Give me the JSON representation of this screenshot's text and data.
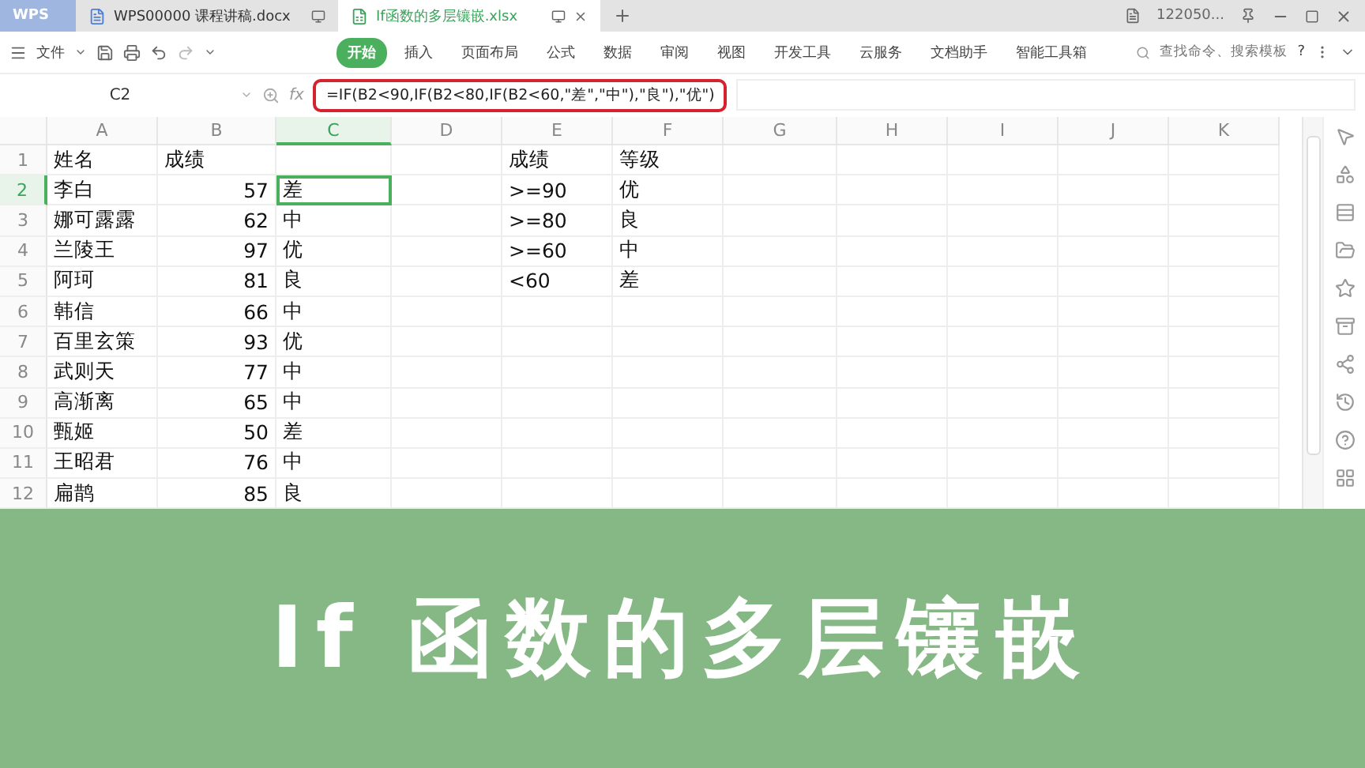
{
  "tabs": [
    {
      "label": "WPS",
      "kind": "home",
      "selected": false
    },
    {
      "label": "WPS00000 课程讲稿.docx",
      "kind": "doc",
      "selected": false
    },
    {
      "label": "If函数的多层镶嵌.xlsx",
      "kind": "sheet",
      "selected": true
    }
  ],
  "account": "122050...",
  "menu": {
    "file": "文件",
    "ribbon_tabs": [
      {
        "label": "开始",
        "selected": true
      },
      {
        "label": "插入",
        "selected": false
      },
      {
        "label": "页面布局",
        "selected": false
      },
      {
        "label": "公式",
        "selected": false
      },
      {
        "label": "数据",
        "selected": false
      },
      {
        "label": "审阅",
        "selected": false
      },
      {
        "label": "视图",
        "selected": false
      },
      {
        "label": "开发工具",
        "selected": false
      },
      {
        "label": "云服务",
        "selected": false
      },
      {
        "label": "文档助手",
        "selected": false
      },
      {
        "label": "智能工具箱",
        "selected": false
      }
    ],
    "search": {
      "placeholder": "查找命令、搜索模板"
    },
    "help": "?"
  },
  "formula_bar": {
    "cell": "C2",
    "fx": "fx",
    "formula": "=IF(B2<90,IF(B2<80,IF(B2<60,\"差\",\"中\"),\"良\"),\"优\")"
  },
  "sheet": {
    "columns": [
      {
        "label": "A",
        "selected": false
      },
      {
        "label": "B",
        "selected": false
      },
      {
        "label": "C",
        "selected": true
      },
      {
        "label": "D",
        "selected": false
      },
      {
        "label": "E",
        "selected": false
      },
      {
        "label": "F",
        "selected": false
      },
      {
        "label": "G",
        "selected": false
      },
      {
        "label": "H",
        "selected": false
      },
      {
        "label": "I",
        "selected": false
      },
      {
        "label": "J",
        "selected": false
      },
      {
        "label": "K",
        "selected": false
      }
    ],
    "rows": [
      {
        "number": "1",
        "selected": false,
        "cells": [
          "姓名",
          "成绩",
          "",
          "",
          "成绩",
          "等级"
        ]
      },
      {
        "number": "2",
        "selected": true,
        "cells": [
          "李白",
          "57",
          "差",
          "",
          ">=90",
          "优"
        ]
      },
      {
        "number": "3",
        "selected": false,
        "cells": [
          "娜可露露",
          "62",
          "中",
          "",
          ">=80",
          "良"
        ]
      },
      {
        "number": "4",
        "selected": false,
        "cells": [
          "兰陵王",
          "97",
          "优",
          "",
          ">=60",
          "中"
        ]
      },
      {
        "number": "5",
        "selected": false,
        "cells": [
          "阿珂",
          "81",
          "良",
          "",
          "<60",
          "差"
        ]
      },
      {
        "number": "6",
        "selected": false,
        "cells": [
          "韩信",
          "66",
          "中"
        ]
      },
      {
        "number": "7",
        "selected": false,
        "cells": [
          "百里玄策",
          "93",
          "优"
        ]
      },
      {
        "number": "8",
        "selected": false,
        "cells": [
          "武则天",
          "77",
          "中"
        ]
      },
      {
        "number": "9",
        "selected": false,
        "cells": [
          "高渐离",
          "65",
          "中"
        ]
      },
      {
        "number": "10",
        "selected": false,
        "cells": [
          "甄姬",
          "50",
          "差"
        ]
      },
      {
        "number": "11",
        "selected": false,
        "cells": [
          "王昭君",
          "76",
          "中"
        ]
      },
      {
        "number": "12",
        "selected": false,
        "cells": [
          "扁鹊",
          "85",
          "良"
        ]
      }
    ]
  },
  "banner": {
    "title": "If 函数的多层镶嵌"
  }
}
